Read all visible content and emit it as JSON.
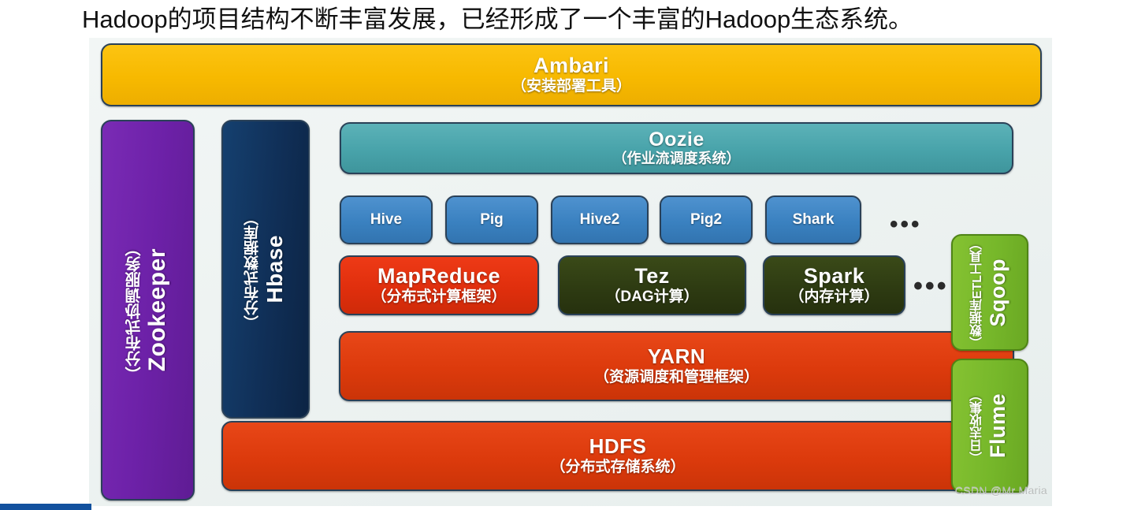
{
  "slide": {
    "title": "Hadoop的项目结构不断丰富发展，已经形成了一个丰富的Hadoop生态系统。",
    "watermark": "CSDN @Mr Maria"
  },
  "diagram": {
    "type": "layered-stack",
    "title": "Hadoop 生态系统",
    "ellipsis": "•••",
    "colors": {
      "ambari": "#f7b900",
      "zookeeper": "#6d21a8",
      "hbase": "#102f57",
      "oozie": "#48a3aa",
      "chip_blue": "#3a81c0",
      "mapreduce_red": "#e02f0d",
      "tez_green": "#2e3b12",
      "yarn_orange": "#dc3a0c",
      "hdfs_orange": "#dc3a0c",
      "sqoop_green": "#76b72a",
      "flume_green": "#76b72a",
      "panel_bg": "#eef3f2",
      "node_border": "#2a4158",
      "bottom_bar": "#12519e"
    },
    "nodes": {
      "ambari": {
        "name": "Ambari",
        "sub": "（安装部署工具）"
      },
      "zookeeper": {
        "name": "Zookeeper",
        "sub": "（分布式协调服务）"
      },
      "hbase": {
        "name": "Hbase",
        "sub": "（分布式数据库）"
      },
      "oozie": {
        "name": "Oozie",
        "sub": "（作业流调度系统）"
      },
      "mapreduce": {
        "name": "MapReduce",
        "sub": "（分布式计算框架）"
      },
      "tez": {
        "name": "Tez",
        "sub": "（DAG计算）"
      },
      "spark": {
        "name": "Spark",
        "sub": "（内存计算）"
      },
      "yarn": {
        "name": "YARN",
        "sub": "（资源调度和管理框架）"
      },
      "hdfs": {
        "name": "HDFS",
        "sub": "（分布式存储系统）"
      },
      "sqoop": {
        "name": "Sqoop",
        "sub": "（数据库ETL工具）"
      },
      "flume": {
        "name": "Flume",
        "sub": "（日志收集）"
      }
    },
    "chips": [
      {
        "label": "Hive"
      },
      {
        "label": "Pig"
      },
      {
        "label": "Hive2"
      },
      {
        "label": "Pig2"
      },
      {
        "label": "Shark"
      }
    ]
  }
}
